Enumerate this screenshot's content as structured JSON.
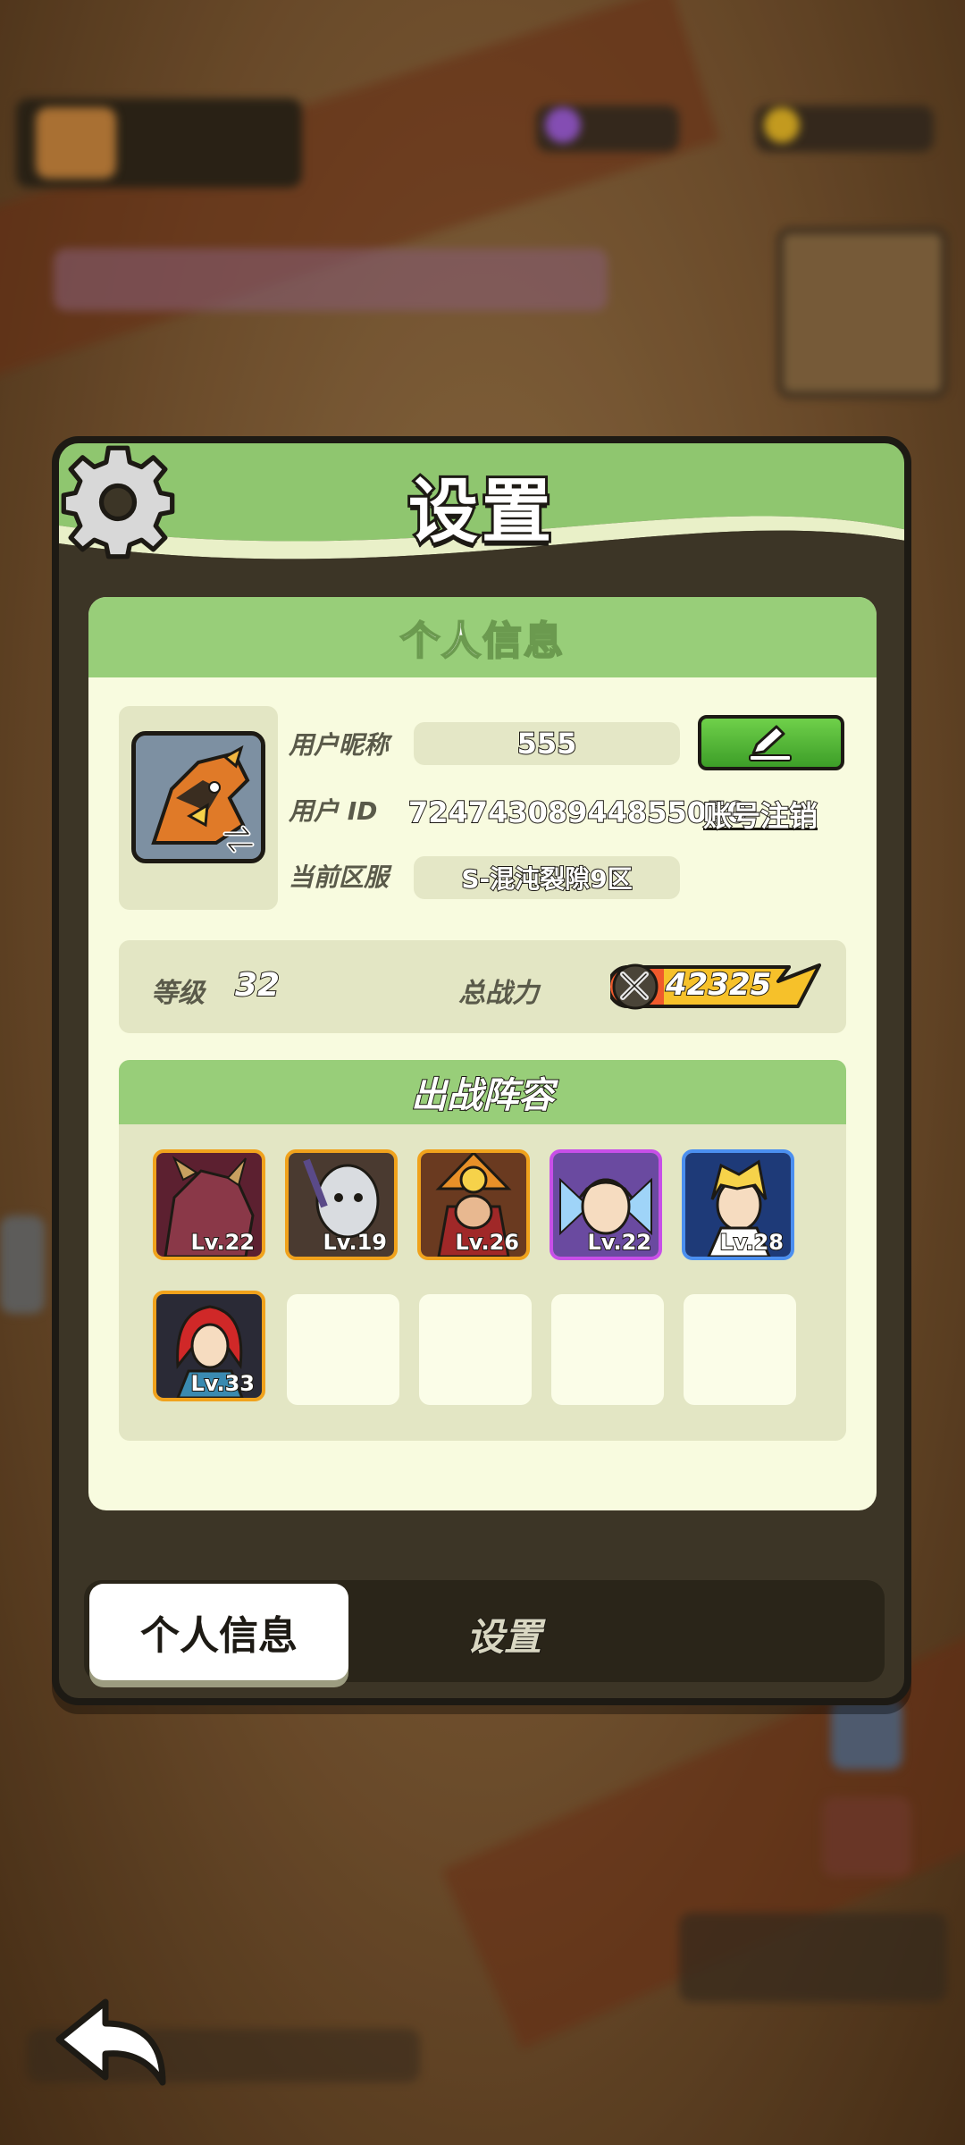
{
  "panel": {
    "title": "设置"
  },
  "personal_info": {
    "section_title": "个人信息",
    "nickname_label": "用户昵称",
    "nickname_value": "555",
    "id_label": "用户  ID",
    "id_value": "72474308944855050",
    "delete_account_label": "账号注销",
    "server_label": "当前区服",
    "server_value": "S-混沌裂隙9区",
    "level_label": "等级",
    "level_value": "32",
    "power_label": "总战力",
    "power_value": "42325"
  },
  "lineup": {
    "title": "出战阵容",
    "heroes": [
      {
        "level": "Lv.22",
        "rarity": "gold"
      },
      {
        "level": "Lv.19",
        "rarity": "gold"
      },
      {
        "level": "Lv.26",
        "rarity": "gold"
      },
      {
        "level": "Lv.22",
        "rarity": "purple"
      },
      {
        "level": "Lv.28",
        "rarity": "blue"
      },
      {
        "level": "Lv.33",
        "rarity": "gold"
      }
    ],
    "empty_slots": 4
  },
  "tabs": {
    "personal_info": "个人信息",
    "settings": "设置"
  },
  "colors": {
    "header_green": "#98ce79",
    "content_bg": "#f8fbdf",
    "panel_bg": "#3c3526",
    "gold_frame": "#f0a21c",
    "purple_frame": "#c84fe8",
    "blue_frame": "#4b8ff0",
    "edit_button": "#4fb533"
  },
  "icons": [
    "gear-icon",
    "pencil-icon",
    "swap-icon",
    "crossed-swords-icon",
    "back-arrow-icon"
  ]
}
